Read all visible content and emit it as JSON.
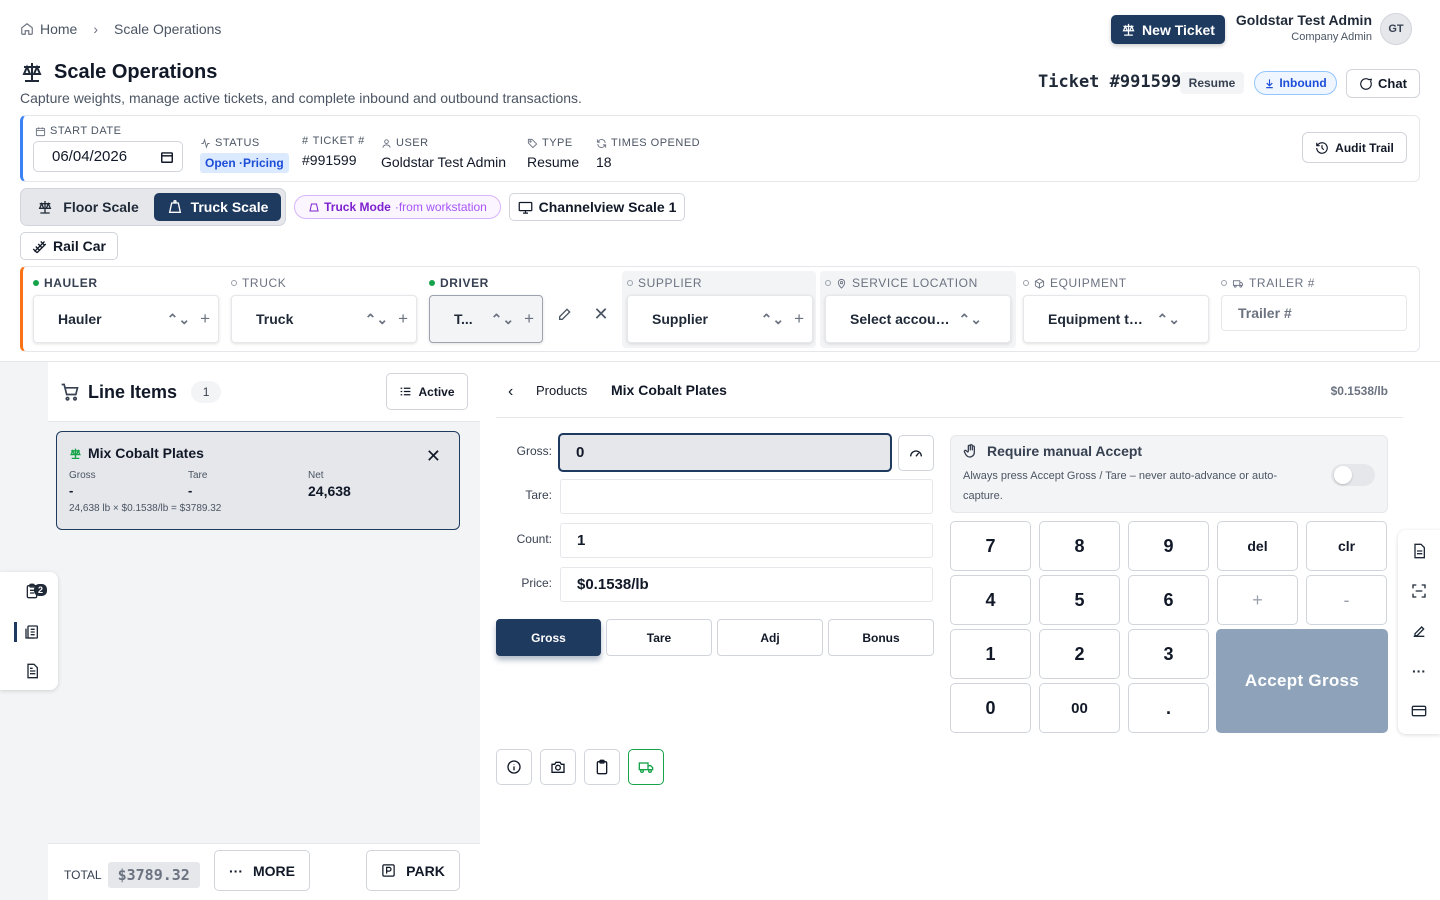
{
  "breadcrumb": {
    "home": "Home",
    "current": "Scale Operations"
  },
  "header": {
    "new_ticket": "New Ticket",
    "user_name": "Goldstar Test Admin",
    "user_role": "Company Admin",
    "avatar": "GT"
  },
  "page": {
    "title": "Scale Operations",
    "subtitle": "Capture weights, manage active tickets, and complete inbound and outbound transactions."
  },
  "ticket": {
    "number": "Ticket #991599",
    "resume": "Resume",
    "inbound": "Inbound",
    "chat": "Chat"
  },
  "info": {
    "start_date_label": "START DATE",
    "start_date": "06/04/2026",
    "status_label": "STATUS",
    "status": "Open ·Pricing",
    "ticket_label": "TICKET #",
    "ticket": "#991599",
    "user_label": "USER",
    "user": "Goldstar Test Admin",
    "type_label": "TYPE",
    "type": "Resume",
    "times_label": "TIMES OPENED",
    "times": "18",
    "audit": "Audit Trail"
  },
  "scale": {
    "floor": "Floor Scale",
    "truck": "Truck Scale",
    "truck_mode": "Truck Mode",
    "from_ws": "·from workstation",
    "channel": "Channelview Scale 1",
    "rail": "Rail Car"
  },
  "parties": {
    "hauler_label": "HAULER",
    "hauler": "Hauler",
    "truck_label": "TRUCK",
    "truck": "Truck",
    "driver_label": "DRIVER",
    "driver": "T...",
    "supplier_label": "SUPPLIER",
    "supplier": "Supplier",
    "service_label": "SERVICE LOCATION",
    "service": "Select accoun...",
    "equipment_label": "EQUIPMENT",
    "equipment": "Equipment type",
    "trailer_label": "TRAILER #",
    "trailer_placeholder": "Trailer #"
  },
  "line_items": {
    "title": "Line Items",
    "count": "1",
    "filter": "Active",
    "items": [
      {
        "name": "Mix Cobalt Plates",
        "gross_label": "Gross",
        "gross": "-",
        "tare_label": "Tare",
        "tare": "-",
        "net_label": "Net",
        "net": "24,638",
        "calc": "24,638 lb × $0.1538/lb = $3789.32"
      }
    ]
  },
  "footer": {
    "total_label": "TOTAL",
    "total": "$3789.32",
    "more": "MORE",
    "park": "PARK"
  },
  "rail": {
    "badge": "2"
  },
  "product": {
    "crumb": "Products",
    "name": "Mix Cobalt Plates",
    "price": "$0.1538/lb"
  },
  "fields": {
    "gross_label": "Gross:",
    "gross": "0",
    "tare_label": "Tare:",
    "tare": "",
    "count_label": "Count:",
    "count": "1",
    "price_label": "Price:",
    "price": "$0.1538/lb"
  },
  "modes": [
    "Gross",
    "Tare",
    "Adj",
    "Bonus"
  ],
  "manual": {
    "title": "Require manual Accept",
    "desc": "Always press Accept Gross / Tare – never auto-advance or auto-capture."
  },
  "keypad": {
    "k7": "7",
    "k8": "8",
    "k9": "9",
    "del": "del",
    "clr": "clr",
    "k4": "4",
    "k5": "5",
    "k6": "6",
    "plus": "+",
    "minus": "-",
    "k1": "1",
    "k2": "2",
    "k3": "3",
    "k0": "0",
    "k00": "00",
    "dot": ".",
    "accept": "Accept Gross"
  }
}
